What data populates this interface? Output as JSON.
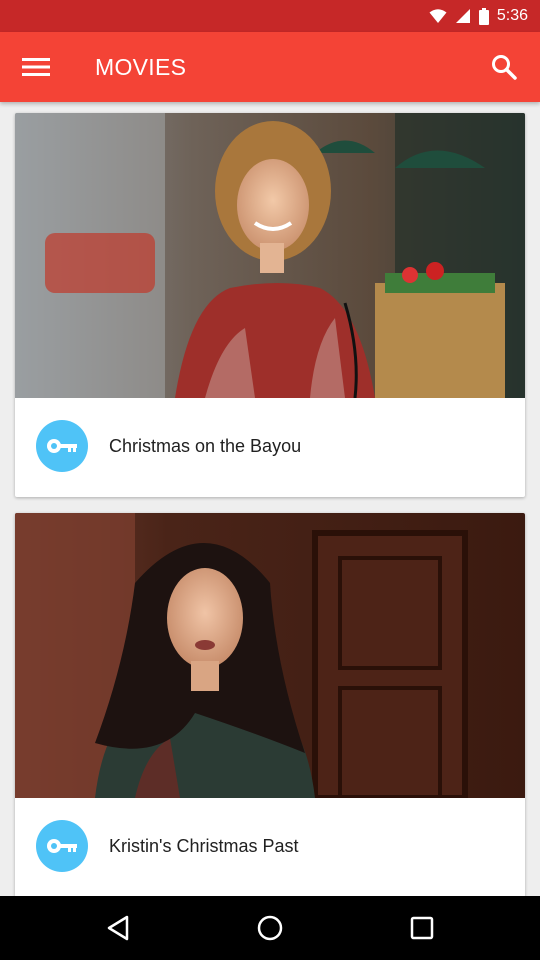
{
  "status_bar": {
    "time": "5:36",
    "icons": [
      "wifi-icon",
      "signal-icon",
      "battery-icon"
    ]
  },
  "app_bar": {
    "title": "MOVIES",
    "icons": [
      "menu-icon",
      "search-icon"
    ],
    "color": "#f44336"
  },
  "movies": [
    {
      "title": "Christmas on the Bayou",
      "icon": "key-icon"
    },
    {
      "title": "Kristin's Christmas Past",
      "icon": "key-icon"
    }
  ],
  "nav_bar": {
    "icons": [
      "back-icon",
      "home-icon",
      "recents-icon"
    ]
  },
  "colors": {
    "status_bar": "#c62828",
    "accent": "#4fc3f7"
  }
}
